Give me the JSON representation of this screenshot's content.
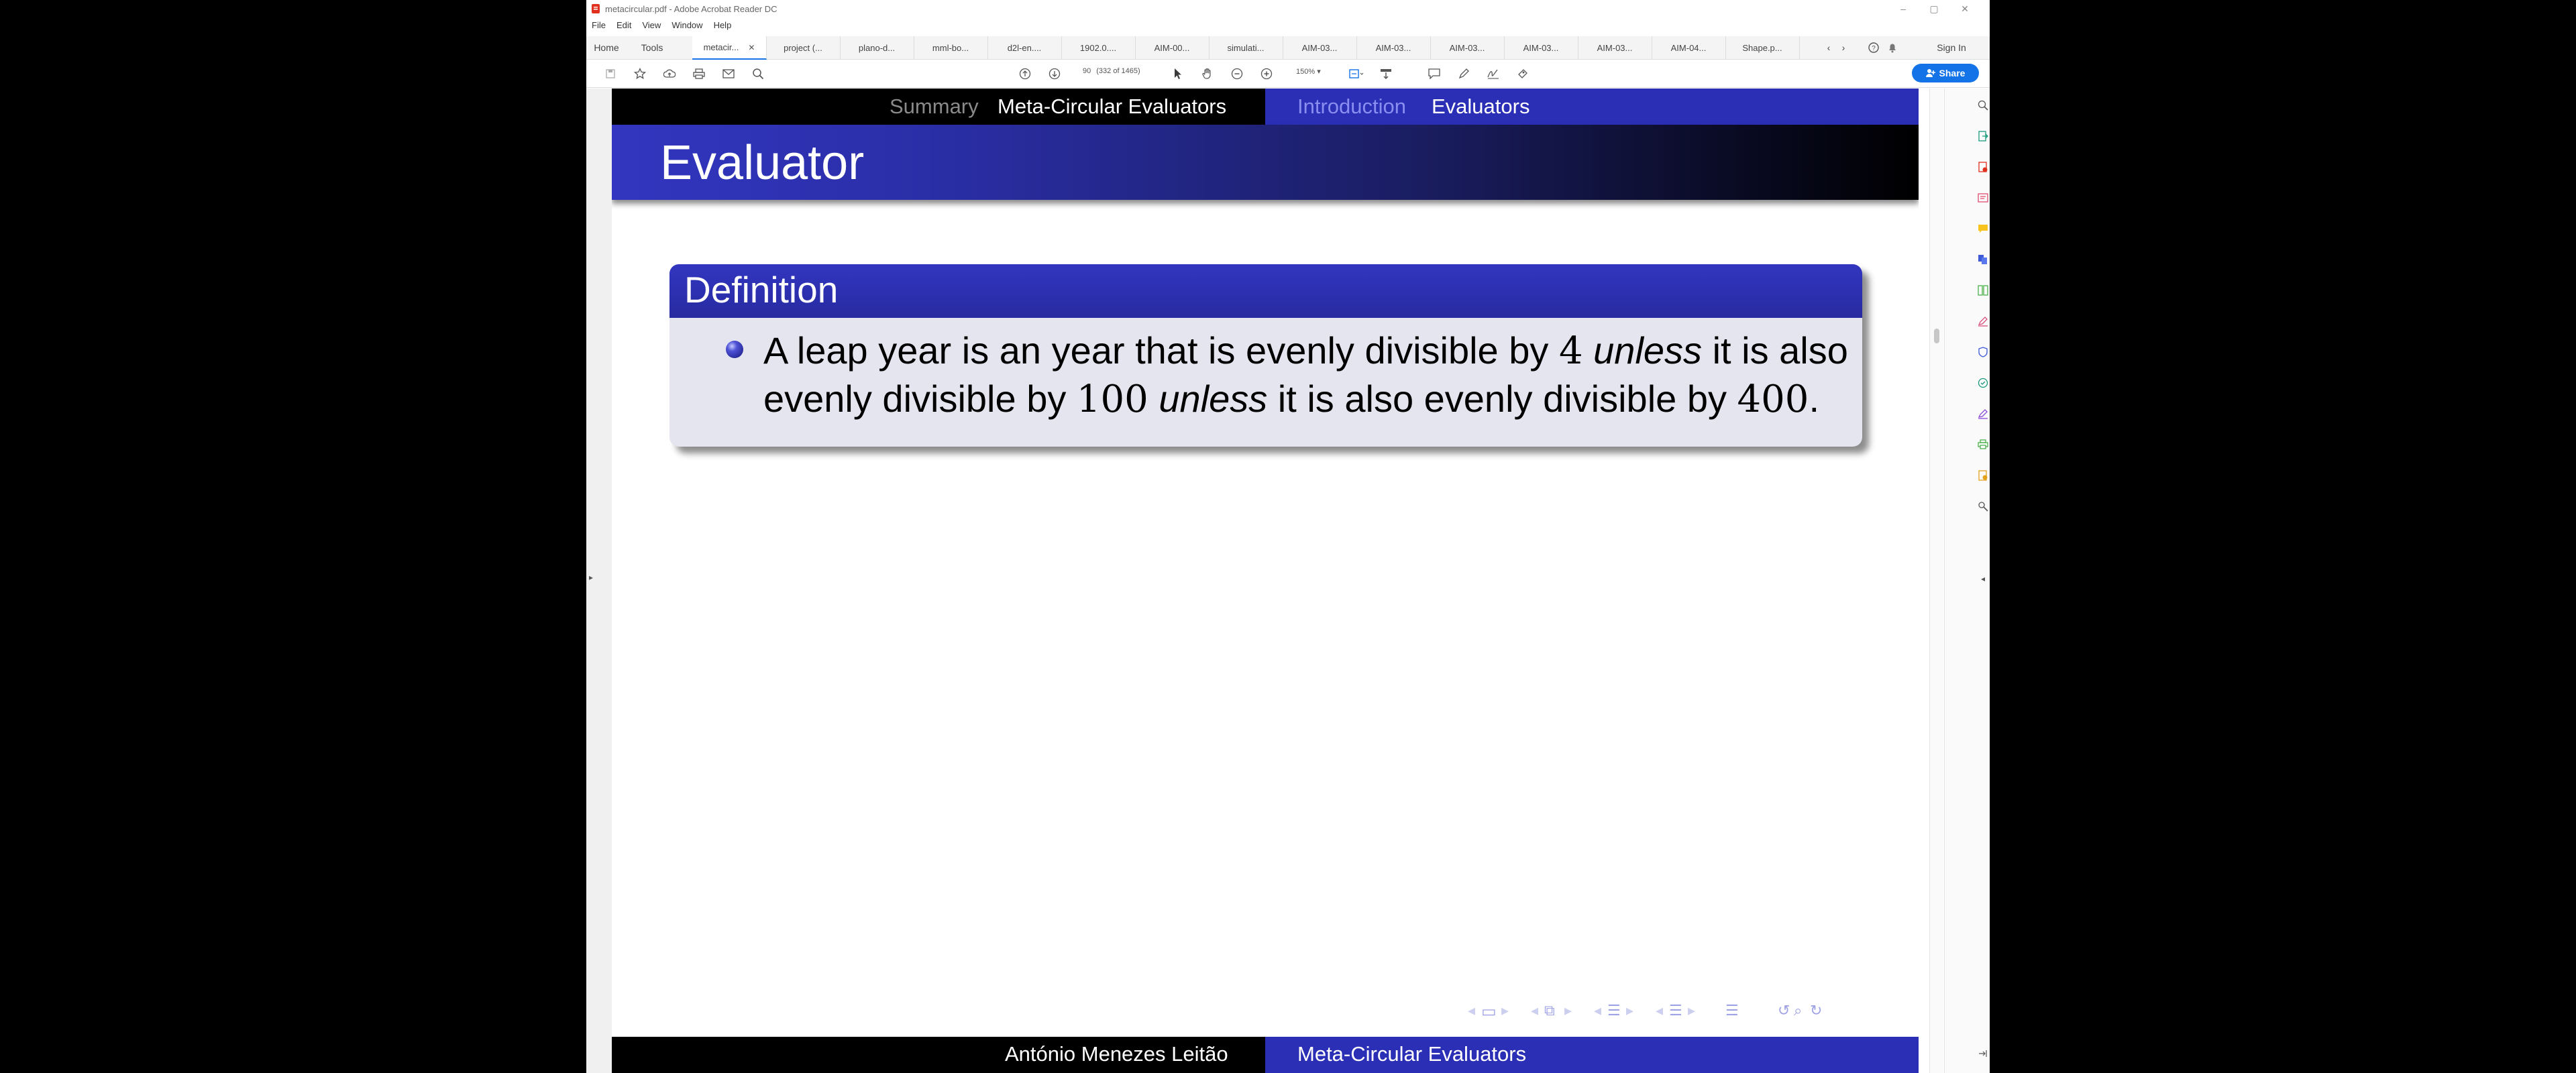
{
  "window": {
    "title": "metacircular.pdf - Adobe Acrobat Reader DC",
    "controls": [
      "–",
      "▢",
      "✕"
    ]
  },
  "menu": [
    "File",
    "Edit",
    "View",
    "Window",
    "Help"
  ],
  "tabs": {
    "home": "Home",
    "tools": "Tools",
    "documents": [
      "metacir...",
      "project (...",
      "plano-d...",
      "mml-bo...",
      "d2l-en....",
      "1902.0....",
      "AIM-00...",
      "simulati...",
      "AIM-03...",
      "AIM-03...",
      "AIM-03...",
      "AIM-03...",
      "AIM-03...",
      "AIM-04...",
      "Shape.p..."
    ],
    "active_index": 0,
    "sign_in": "Sign In"
  },
  "toolbar": {
    "page_number": "90",
    "page_of": "(332 of 1465)",
    "zoom": "150%",
    "share_label": "Share"
  },
  "slide": {
    "nav_top": {
      "section_prev": "Summary",
      "section_current": "Meta-Circular Evaluators",
      "subsection_prev": "Introduction",
      "subsection_current": "Evaluators"
    },
    "frame_title": "Evaluator",
    "block_title": "Definition",
    "definition": {
      "l1a": "A leap year is an year that is evenly divisible by ",
      "n1": "4",
      "u1": "unless",
      "l1b": " it is also",
      "l2a": "evenly divisible by ",
      "n2": "100",
      "u2": "unless",
      "l2b": " it is also evenly divisible by ",
      "n3": "400",
      "end": "."
    },
    "footer": {
      "author": "António Menezes Leitão",
      "title": "Meta-Circular Evaluators"
    }
  },
  "colors": {
    "beamer_blue": "#2b2fb6",
    "acrobat_blue": "#1473e6"
  }
}
